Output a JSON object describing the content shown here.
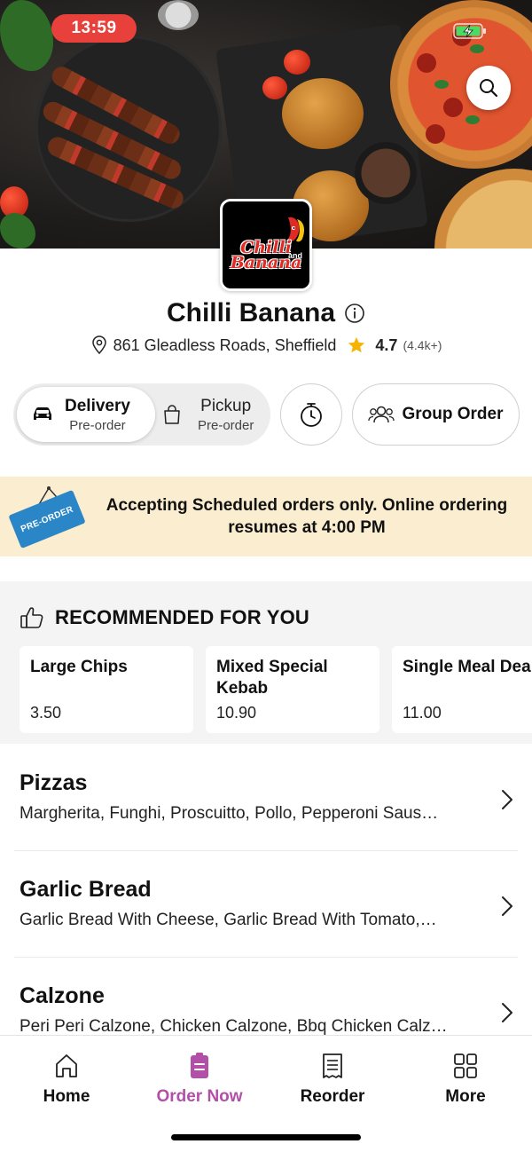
{
  "status_bar": {
    "time": "13:59",
    "battery_icon": "battery-charging-icon"
  },
  "restaurant": {
    "logo_text_line1": "Chilli",
    "logo_text_and": "and",
    "logo_text_line2": "Banana",
    "name": "Chilli Banana",
    "address": "861 Gleadless Roads, Sheffield",
    "rating": "4.7",
    "rating_count": "(4.4k+)"
  },
  "order_mode": {
    "delivery_label": "Delivery",
    "delivery_sub": "Pre-order",
    "pickup_label": "Pickup",
    "pickup_sub": "Pre-order",
    "active": "delivery"
  },
  "group_order_label": "Group Order",
  "banner": {
    "sign_text": "PRE-ORDER",
    "message": "Accepting Scheduled orders only. Online ordering resumes at 4:00 PM"
  },
  "recommended": {
    "heading": "RECOMMENDED FOR YOU",
    "items": [
      {
        "name": "Large Chips",
        "price": "3.50"
      },
      {
        "name": "Mixed Special Kebab",
        "price": "10.90"
      },
      {
        "name": "Single Meal Dea",
        "price": "11.00"
      }
    ]
  },
  "categories": [
    {
      "title": "Pizzas",
      "desc": "Margherita, Funghi, Proscuitto, Pollo, Pepperoni Saus…"
    },
    {
      "title": "Garlic Bread",
      "desc": "Garlic Bread With Cheese, Garlic Bread With Tomato,…"
    },
    {
      "title": "Calzone",
      "desc": "Peri Peri Calzone, Chicken Calzone, Bbq Chicken Calz…"
    }
  ],
  "bottom_nav": {
    "items": [
      {
        "label": "Home",
        "icon": "home-icon"
      },
      {
        "label": "Order Now",
        "icon": "order-icon"
      },
      {
        "label": "Reorder",
        "icon": "receipt-icon"
      },
      {
        "label": "More",
        "icon": "grid-icon"
      }
    ],
    "active_index": 1
  },
  "colors": {
    "accent": "#b24fa7",
    "time_pill": "#e8403a",
    "banner_bg": "#fbeed0",
    "star": "#f5b400",
    "sign_blue": "#2a86c7"
  }
}
